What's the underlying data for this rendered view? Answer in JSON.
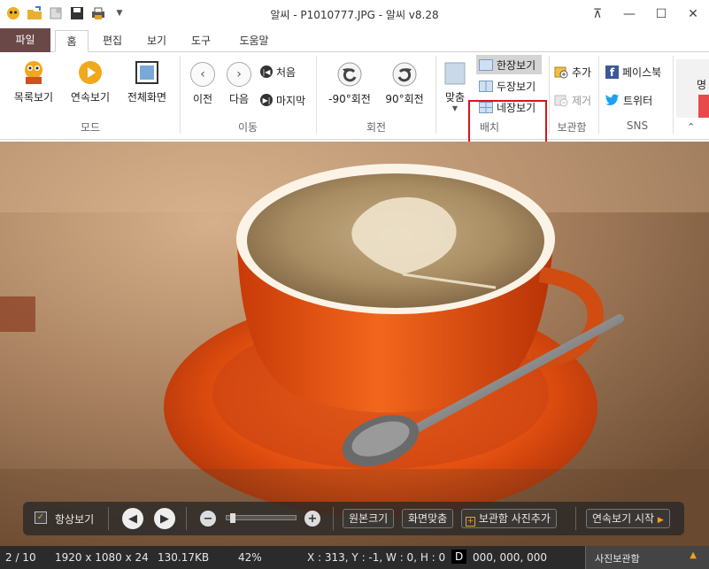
{
  "title": "알씨 - P1010777.JPG - 알씨 v8.28",
  "window_controls": {
    "restore_aux": "⊼",
    "minimize": "—",
    "maximize": "☐",
    "close": "✕"
  },
  "tabs": [
    {
      "label": "파일"
    },
    {
      "label": "홈"
    },
    {
      "label": "편집"
    },
    {
      "label": "보기"
    },
    {
      "label": "도구"
    },
    {
      "label": "도움말"
    }
  ],
  "ribbon": {
    "mode": {
      "list": "목록보기",
      "slideshow": "연속보기",
      "fullscreen": "전체화면",
      "group": "모드"
    },
    "move": {
      "prev": "이전",
      "next": "다음",
      "first": "처음",
      "last": "마지막",
      "group": "이동"
    },
    "rotate": {
      "left": "-90°회전",
      "right": "90°회전",
      "group": "회전"
    },
    "fit": {
      "label": "맞춤"
    },
    "layout": {
      "single": "한장보기",
      "double": "두장보기",
      "quad": "네장보기",
      "group": "배치"
    },
    "album": {
      "add": "추가",
      "remove": "제거",
      "group": "보관함"
    },
    "sns": {
      "facebook": "페이스북",
      "twitter": "트위터",
      "group": "SNS"
    },
    "extra_label": "명"
  },
  "floatbar": {
    "always_label": "항상보기",
    "actual_size": "원본크기",
    "fit_screen": "화면맞춤",
    "add_album": "보관함 사진추가",
    "slideshow_start": "연속보기 시작",
    "zoom_level": 0.05
  },
  "status": {
    "index": "2 / 10",
    "dimensions": "1920 x 1080 x 24",
    "filesize": "130.17KB",
    "zoom": "42%",
    "coords": "X : 313, Y : -1, W : 0, H : 0",
    "d": "D",
    "rgb": "000, 000, 000",
    "album_button": "사진보관함"
  },
  "colors": {
    "file_tab": "#6b4848",
    "highlight": "#d9141c",
    "accent": "#f0a020"
  }
}
